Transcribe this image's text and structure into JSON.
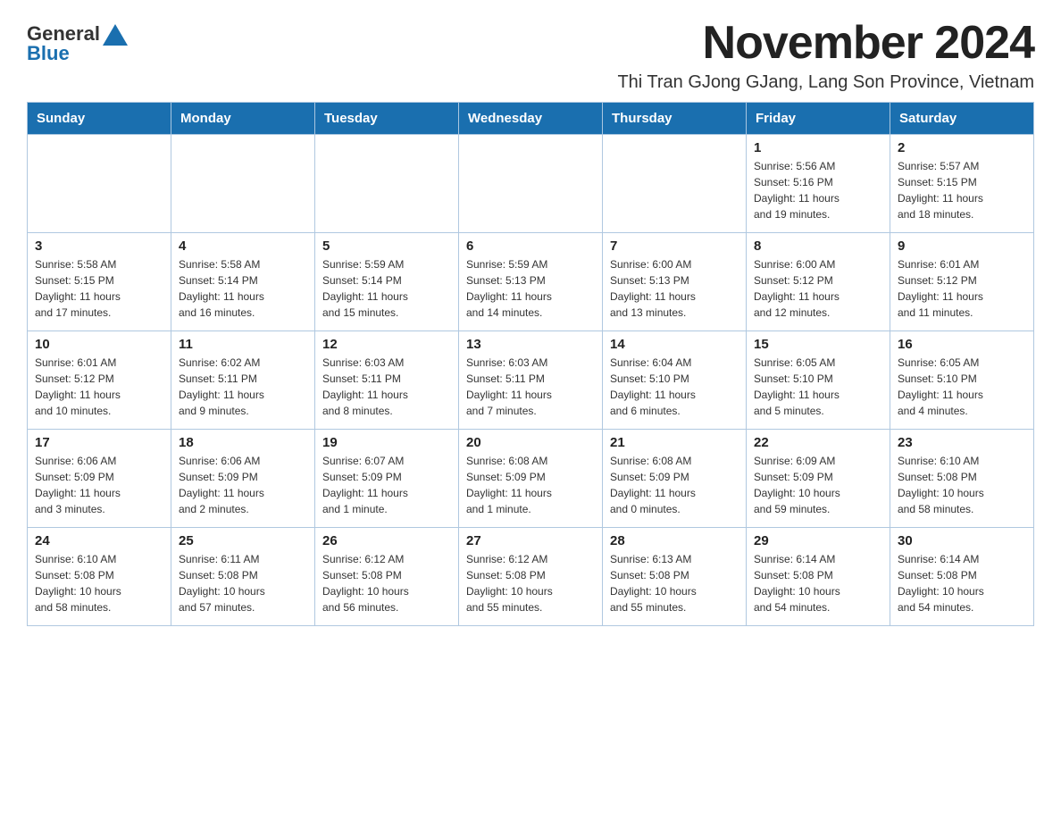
{
  "header": {
    "logo_general": "General",
    "logo_blue": "Blue",
    "month_title": "November 2024",
    "location": "Thi Tran GJong GJang, Lang Son Province, Vietnam"
  },
  "days_of_week": [
    "Sunday",
    "Monday",
    "Tuesday",
    "Wednesday",
    "Thursday",
    "Friday",
    "Saturday"
  ],
  "weeks": [
    [
      {
        "day": "",
        "info": ""
      },
      {
        "day": "",
        "info": ""
      },
      {
        "day": "",
        "info": ""
      },
      {
        "day": "",
        "info": ""
      },
      {
        "day": "",
        "info": ""
      },
      {
        "day": "1",
        "info": "Sunrise: 5:56 AM\nSunset: 5:16 PM\nDaylight: 11 hours\nand 19 minutes."
      },
      {
        "day": "2",
        "info": "Sunrise: 5:57 AM\nSunset: 5:15 PM\nDaylight: 11 hours\nand 18 minutes."
      }
    ],
    [
      {
        "day": "3",
        "info": "Sunrise: 5:58 AM\nSunset: 5:15 PM\nDaylight: 11 hours\nand 17 minutes."
      },
      {
        "day": "4",
        "info": "Sunrise: 5:58 AM\nSunset: 5:14 PM\nDaylight: 11 hours\nand 16 minutes."
      },
      {
        "day": "5",
        "info": "Sunrise: 5:59 AM\nSunset: 5:14 PM\nDaylight: 11 hours\nand 15 minutes."
      },
      {
        "day": "6",
        "info": "Sunrise: 5:59 AM\nSunset: 5:13 PM\nDaylight: 11 hours\nand 14 minutes."
      },
      {
        "day": "7",
        "info": "Sunrise: 6:00 AM\nSunset: 5:13 PM\nDaylight: 11 hours\nand 13 minutes."
      },
      {
        "day": "8",
        "info": "Sunrise: 6:00 AM\nSunset: 5:12 PM\nDaylight: 11 hours\nand 12 minutes."
      },
      {
        "day": "9",
        "info": "Sunrise: 6:01 AM\nSunset: 5:12 PM\nDaylight: 11 hours\nand 11 minutes."
      }
    ],
    [
      {
        "day": "10",
        "info": "Sunrise: 6:01 AM\nSunset: 5:12 PM\nDaylight: 11 hours\nand 10 minutes."
      },
      {
        "day": "11",
        "info": "Sunrise: 6:02 AM\nSunset: 5:11 PM\nDaylight: 11 hours\nand 9 minutes."
      },
      {
        "day": "12",
        "info": "Sunrise: 6:03 AM\nSunset: 5:11 PM\nDaylight: 11 hours\nand 8 minutes."
      },
      {
        "day": "13",
        "info": "Sunrise: 6:03 AM\nSunset: 5:11 PM\nDaylight: 11 hours\nand 7 minutes."
      },
      {
        "day": "14",
        "info": "Sunrise: 6:04 AM\nSunset: 5:10 PM\nDaylight: 11 hours\nand 6 minutes."
      },
      {
        "day": "15",
        "info": "Sunrise: 6:05 AM\nSunset: 5:10 PM\nDaylight: 11 hours\nand 5 minutes."
      },
      {
        "day": "16",
        "info": "Sunrise: 6:05 AM\nSunset: 5:10 PM\nDaylight: 11 hours\nand 4 minutes."
      }
    ],
    [
      {
        "day": "17",
        "info": "Sunrise: 6:06 AM\nSunset: 5:09 PM\nDaylight: 11 hours\nand 3 minutes."
      },
      {
        "day": "18",
        "info": "Sunrise: 6:06 AM\nSunset: 5:09 PM\nDaylight: 11 hours\nand 2 minutes."
      },
      {
        "day": "19",
        "info": "Sunrise: 6:07 AM\nSunset: 5:09 PM\nDaylight: 11 hours\nand 1 minute."
      },
      {
        "day": "20",
        "info": "Sunrise: 6:08 AM\nSunset: 5:09 PM\nDaylight: 11 hours\nand 1 minute."
      },
      {
        "day": "21",
        "info": "Sunrise: 6:08 AM\nSunset: 5:09 PM\nDaylight: 11 hours\nand 0 minutes."
      },
      {
        "day": "22",
        "info": "Sunrise: 6:09 AM\nSunset: 5:09 PM\nDaylight: 10 hours\nand 59 minutes."
      },
      {
        "day": "23",
        "info": "Sunrise: 6:10 AM\nSunset: 5:08 PM\nDaylight: 10 hours\nand 58 minutes."
      }
    ],
    [
      {
        "day": "24",
        "info": "Sunrise: 6:10 AM\nSunset: 5:08 PM\nDaylight: 10 hours\nand 58 minutes."
      },
      {
        "day": "25",
        "info": "Sunrise: 6:11 AM\nSunset: 5:08 PM\nDaylight: 10 hours\nand 57 minutes."
      },
      {
        "day": "26",
        "info": "Sunrise: 6:12 AM\nSunset: 5:08 PM\nDaylight: 10 hours\nand 56 minutes."
      },
      {
        "day": "27",
        "info": "Sunrise: 6:12 AM\nSunset: 5:08 PM\nDaylight: 10 hours\nand 55 minutes."
      },
      {
        "day": "28",
        "info": "Sunrise: 6:13 AM\nSunset: 5:08 PM\nDaylight: 10 hours\nand 55 minutes."
      },
      {
        "day": "29",
        "info": "Sunrise: 6:14 AM\nSunset: 5:08 PM\nDaylight: 10 hours\nand 54 minutes."
      },
      {
        "day": "30",
        "info": "Sunrise: 6:14 AM\nSunset: 5:08 PM\nDaylight: 10 hours\nand 54 minutes."
      }
    ]
  ]
}
